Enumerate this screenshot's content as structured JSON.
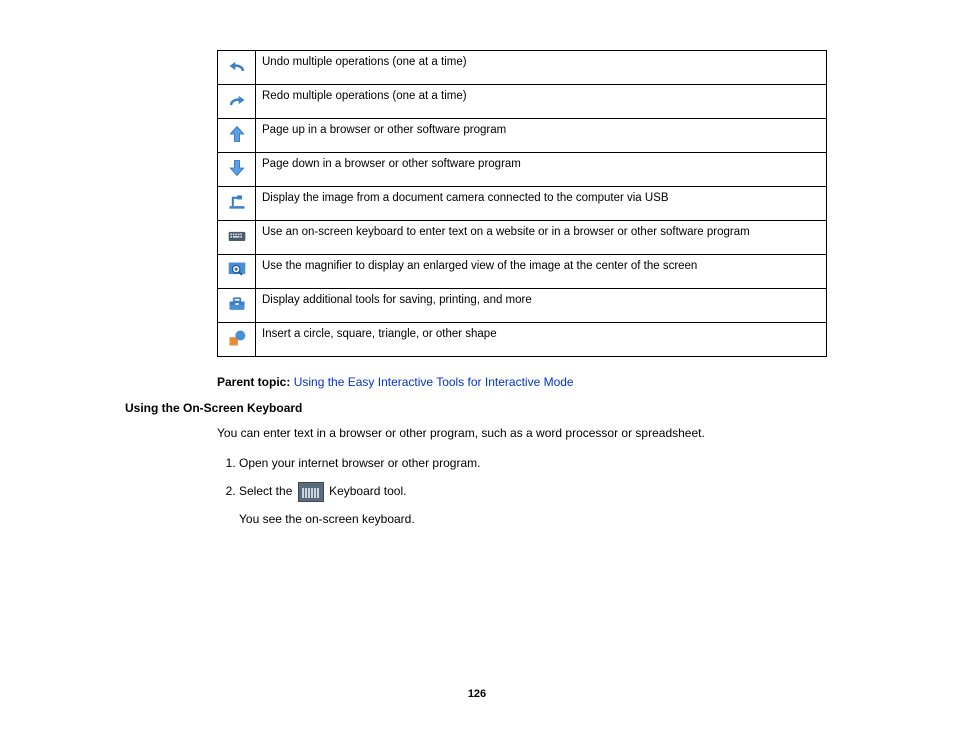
{
  "tools": [
    {
      "icon": "undo-icon",
      "desc": "Undo multiple operations (one at a time)"
    },
    {
      "icon": "redo-icon",
      "desc": "Redo multiple operations (one at a time)"
    },
    {
      "icon": "page-up-icon",
      "desc": "Page up in a browser or other software program"
    },
    {
      "icon": "page-down-icon",
      "desc": "Page down in a browser or other software program"
    },
    {
      "icon": "doc-camera-icon",
      "desc": "Display the image from a document camera connected to the computer via USB"
    },
    {
      "icon": "keyboard-icon",
      "desc": "Use an on-screen keyboard to enter text on a website or in a browser or other software program"
    },
    {
      "icon": "magnifier-icon",
      "desc": "Use the magnifier to display an enlarged view of the image at the center of the screen"
    },
    {
      "icon": "toolbox-icon",
      "desc": "Display additional tools for saving, printing, and more"
    },
    {
      "icon": "shapes-icon",
      "desc": "Insert a circle, square, triangle, or other shape"
    }
  ],
  "parent_topic": {
    "label": "Parent topic:",
    "link_text": "Using the Easy Interactive Tools for Interactive Mode"
  },
  "section": {
    "heading": "Using the On-Screen Keyboard",
    "intro": "You can enter text in a browser or other program, such as a word processor or spreadsheet.",
    "steps": {
      "s1": "Open your internet browser or other program.",
      "s2_a": "Select the",
      "s2_b": "Keyboard tool.",
      "s2_sub": "You see the on-screen keyboard."
    }
  },
  "page_number": "126"
}
